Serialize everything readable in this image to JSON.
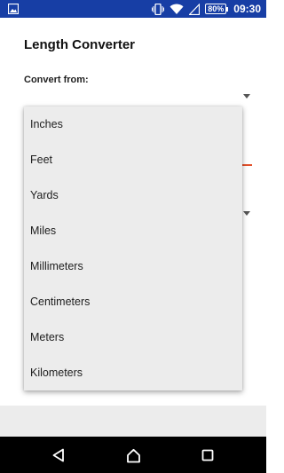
{
  "status_bar": {
    "battery_percent": "80%",
    "time": "09:30",
    "icons": [
      "image-icon",
      "vibrate-icon",
      "wifi-icon",
      "signal-icon",
      "battery-icon"
    ]
  },
  "app": {
    "title": "Length Converter",
    "convert_from_label": "Convert from:"
  },
  "dropdown": {
    "options": [
      "Inches",
      "Feet",
      "Yards",
      "Miles",
      "Millimeters",
      "Centimeters",
      "Meters",
      "Kilometers"
    ]
  },
  "nav_bar": {
    "icons": [
      "back-icon",
      "home-icon",
      "recents-icon"
    ]
  },
  "colors": {
    "status_bar": "#173ea5",
    "accent_line": "#e3522c",
    "dropdown_bg": "#ececec",
    "nav_bar": "#000000"
  }
}
